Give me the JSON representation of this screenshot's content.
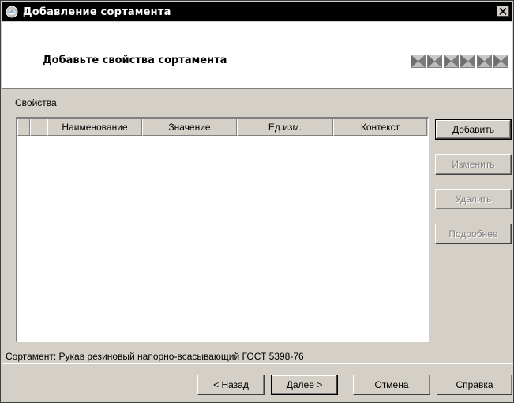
{
  "window": {
    "title": "Добавление сортамента",
    "close_glyph": "✕"
  },
  "header": {
    "title": "Добавьте свойства сортамента",
    "step_icons": [
      "step-icon",
      "step-icon",
      "step-icon",
      "step-icon",
      "step-icon",
      "step-icon"
    ]
  },
  "properties": {
    "group_label": "Свойства",
    "columns": [
      "",
      "Наименование",
      "Значение",
      "Ед.изм.",
      "Контекст"
    ],
    "rows": []
  },
  "side_buttons": {
    "add": "Добавить",
    "edit": "Изменить",
    "delete": "Удалить",
    "details": "Подробнее"
  },
  "status": {
    "text": "Сортамент: Рукав резиновый напорно-всасывающий ГОСТ 5398-76"
  },
  "footer_buttons": {
    "back": "< Назад",
    "next": "Далее >",
    "cancel": "Отмена",
    "help": "Справка"
  },
  "colors": {
    "face": "#d4d0c8",
    "titlebar": "#000000",
    "disabled_text": "#808080"
  }
}
